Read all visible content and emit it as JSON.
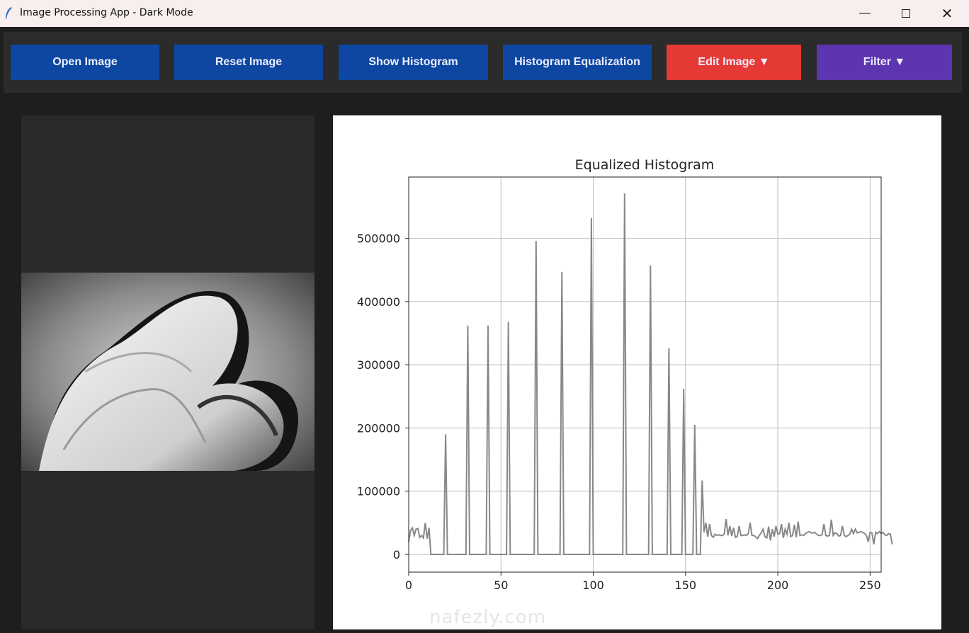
{
  "window": {
    "title": "Image Processing App - Dark Mode",
    "controls": [
      "minimize",
      "maximize",
      "close"
    ]
  },
  "toolbar": {
    "buttons": [
      {
        "label": "Open Image",
        "color": "#0d47a1"
      },
      {
        "label": "Reset Image",
        "color": "#0d47a1"
      },
      {
        "label": "Show Histogram",
        "color": "#0d47a1"
      },
      {
        "label": "Histogram Equalization",
        "color": "#0d47a1"
      },
      {
        "label": "Edit Image ▼",
        "color": "#e53935"
      },
      {
        "label": "Filter ▼",
        "color": "#5e35b1"
      }
    ]
  },
  "watermark": "nafezly.com",
  "chart_data": {
    "type": "line",
    "title": "Equalized Histogram",
    "xlabel": "",
    "ylabel": "",
    "xlim": [
      0,
      256
    ],
    "ylim": [
      -28000,
      597000
    ],
    "xticks": [
      0,
      50,
      100,
      150,
      200,
      250
    ],
    "yticks": [
      0,
      100000,
      200000,
      300000,
      400000,
      500000
    ],
    "grid": true,
    "color": "#888888",
    "x_start": 0,
    "values": [
      20000,
      38000,
      42000,
      30000,
      40000,
      41000,
      27000,
      30000,
      26000,
      50000,
      25000,
      42000,
      0,
      0,
      0,
      0,
      0,
      0,
      0,
      0,
      190000,
      0,
      0,
      0,
      0,
      0,
      0,
      0,
      0,
      0,
      0,
      0,
      362000,
      0,
      0,
      0,
      0,
      0,
      0,
      0,
      0,
      0,
      0,
      362000,
      0,
      0,
      0,
      0,
      0,
      0,
      0,
      0,
      0,
      0,
      368000,
      0,
      0,
      0,
      0,
      0,
      0,
      0,
      0,
      0,
      0,
      0,
      0,
      0,
      0,
      496000,
      0,
      0,
      0,
      0,
      0,
      0,
      0,
      0,
      0,
      0,
      0,
      0,
      0,
      447000,
      0,
      0,
      0,
      0,
      0,
      0,
      0,
      0,
      0,
      0,
      0,
      0,
      0,
      0,
      0,
      532000,
      0,
      0,
      0,
      0,
      0,
      0,
      0,
      0,
      0,
      0,
      0,
      0,
      0,
      0,
      0,
      0,
      0,
      571000,
      0,
      0,
      0,
      0,
      0,
      0,
      0,
      0,
      0,
      0,
      0,
      0,
      0,
      457000,
      0,
      0,
      0,
      0,
      0,
      0,
      0,
      0,
      0,
      326000,
      0,
      0,
      0,
      0,
      0,
      0,
      0,
      262000,
      0,
      0,
      0,
      0,
      0,
      205000,
      0,
      0,
      0,
      117000,
      35000,
      50000,
      28000,
      48000,
      30000,
      27000,
      32000,
      30000,
      31000,
      30000,
      30000,
      32000,
      56000,
      30000,
      45000,
      29000,
      42000,
      27000,
      28000,
      45000,
      30000,
      30000,
      31000,
      30000,
      33000,
      50000,
      30000,
      30000,
      28000,
      25000,
      30000,
      34000,
      40000,
      28000,
      26000,
      44000,
      22000,
      40000,
      28000,
      45000,
      32000,
      33000,
      48000,
      26000,
      40000,
      32000,
      50000,
      28000,
      30000,
      47000,
      27000,
      52000,
      30000,
      31000,
      30000,
      33000,
      35000,
      36000,
      34000,
      34000,
      35000,
      32000,
      30000,
      30000,
      31000,
      48000,
      30000,
      29000,
      30000,
      55000,
      30000,
      34000,
      33000,
      29000,
      30000,
      45000,
      30000,
      28000,
      30000,
      32000,
      40000,
      33000,
      40000,
      34000,
      35000,
      36000,
      35000,
      33000,
      30000,
      20000,
      35000,
      34000,
      16000,
      35000,
      33000,
      36000,
      33000,
      35000,
      31000,
      30000,
      33000,
      32000,
      16000
    ]
  }
}
